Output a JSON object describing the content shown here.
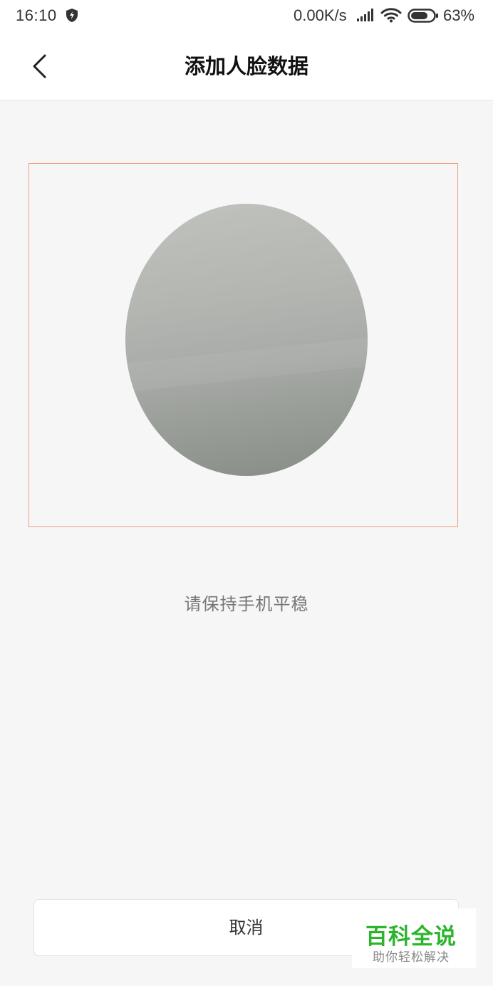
{
  "status_bar": {
    "time": "16:10",
    "net_speed": "0.00K/s",
    "battery_percent": "63%",
    "icons": [
      "shield-icon",
      "signal-icon",
      "wifi-icon",
      "battery-icon"
    ]
  },
  "header": {
    "title": "添加人脸数据",
    "back_icon": "chevron-left-icon"
  },
  "camera": {
    "frame_color": "#f0a07f"
  },
  "main": {
    "instruction": "请保持手机平稳"
  },
  "footer": {
    "cancel_label": "取消"
  },
  "watermark": {
    "title": "百科全说",
    "subtitle": "助你轻松解决",
    "color": "#2bb52b"
  }
}
